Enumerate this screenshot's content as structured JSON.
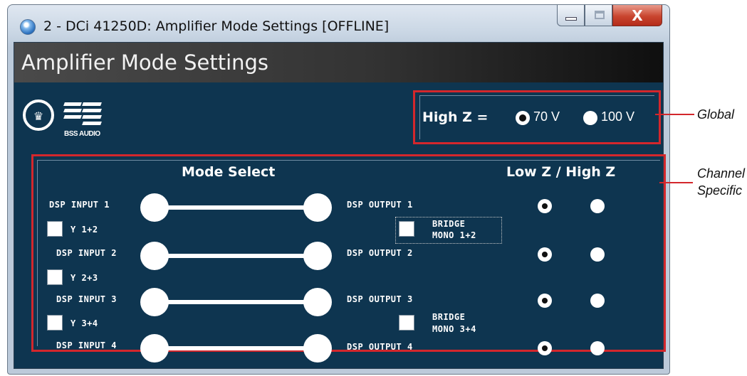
{
  "window": {
    "title": "2 - DCi 41250D: Amplifier Mode Settings [OFFLINE]",
    "close_glyph": "X"
  },
  "header": {
    "title": "Amplifier Mode Settings"
  },
  "logo": {
    "text": "BSS AUDIO"
  },
  "global": {
    "label": "High Z =",
    "options": [
      {
        "label": "70 V",
        "selected": true
      },
      {
        "label": "100 V",
        "selected": false
      }
    ]
  },
  "channel": {
    "mode_select_label": "Mode Select",
    "lowhigh_label": "Low Z / High Z",
    "inputs": [
      "DSP INPUT 1",
      "DSP INPUT 2",
      "DSP INPUT 3",
      "DSP INPUT 4"
    ],
    "outputs": [
      "DSP OUTPUT 1",
      "DSP OUTPUT 2",
      "DSP OUTPUT 3",
      "DSP OUTPUT 4"
    ],
    "y_checkboxes": [
      "Y 1+2",
      "Y 2+3",
      "Y 3+4"
    ],
    "bridge": [
      {
        "line1": "BRIDGE",
        "line2": "MONO 1+2"
      },
      {
        "line1": "BRIDGE",
        "line2": "MONO 3+4"
      }
    ],
    "impedance": [
      {
        "low_z_selected": true
      },
      {
        "low_z_selected": true
      },
      {
        "low_z_selected": true
      },
      {
        "low_z_selected": true
      }
    ]
  },
  "callouts": {
    "global": "Global",
    "channel_line1": "Channel",
    "channel_line2": "Specific"
  }
}
